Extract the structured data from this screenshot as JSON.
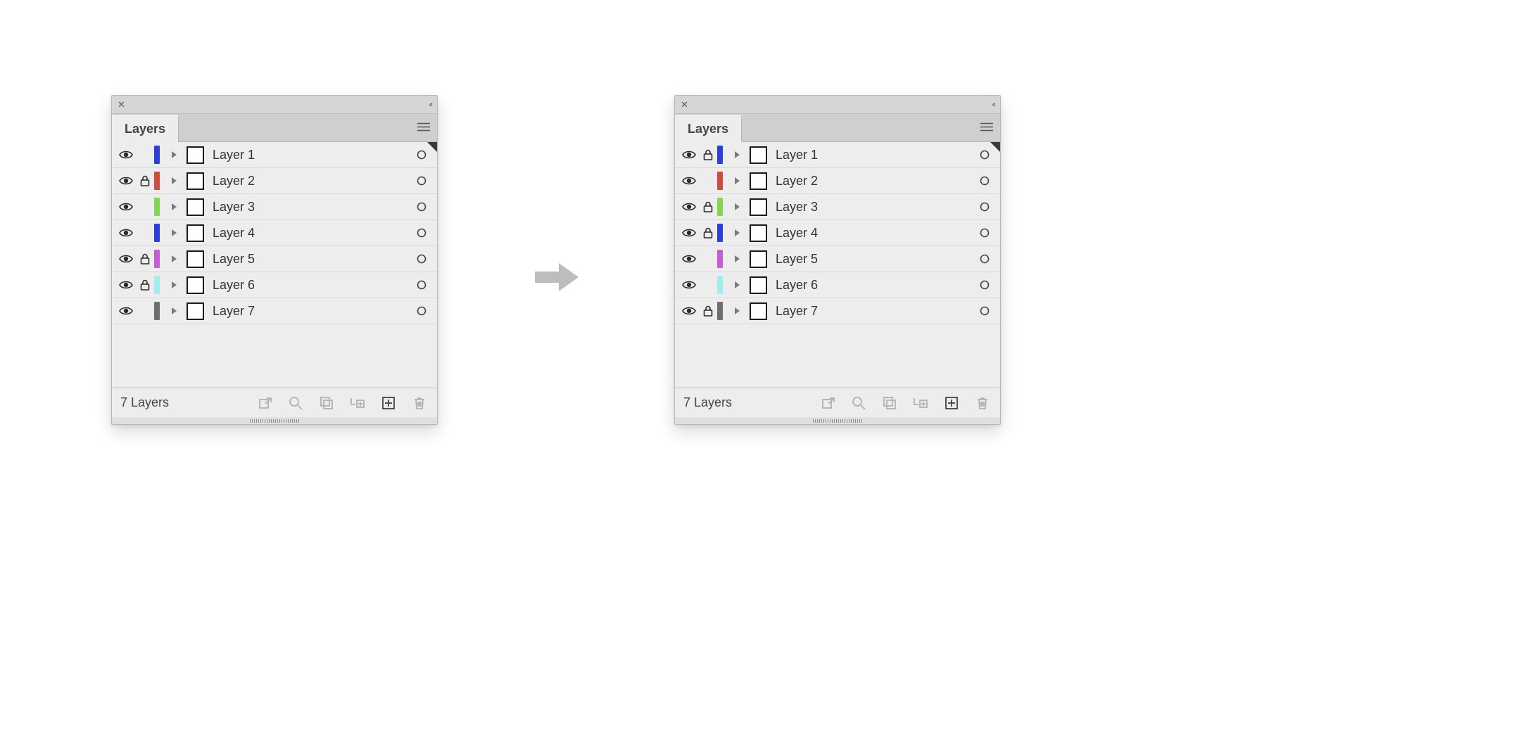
{
  "chrome": {
    "close_glyph": "✕",
    "collapse_glyph": "‹‹"
  },
  "tab": {
    "title": "Layers"
  },
  "panel_before": {
    "rows": [
      {
        "visible": true,
        "locked": false,
        "color": "#2a3fe0",
        "name": "Layer 1"
      },
      {
        "visible": true,
        "locked": true,
        "color": "#cc4d3b",
        "name": "Layer 2"
      },
      {
        "visible": true,
        "locked": false,
        "color": "#7fd84e",
        "name": "Layer 3"
      },
      {
        "visible": true,
        "locked": false,
        "color": "#2a3fe0",
        "name": "Layer 4"
      },
      {
        "visible": true,
        "locked": true,
        "color": "#c85cd8",
        "name": "Layer 5"
      },
      {
        "visible": true,
        "locked": true,
        "color": "#9ef0ef",
        "name": "Layer 6"
      },
      {
        "visible": true,
        "locked": false,
        "color": "#6f6f6f",
        "name": "Layer 7"
      }
    ]
  },
  "panel_after": {
    "rows": [
      {
        "visible": true,
        "locked": true,
        "color": "#2a3fe0",
        "name": "Layer 1"
      },
      {
        "visible": true,
        "locked": false,
        "color": "#cc4d3b",
        "name": "Layer 2"
      },
      {
        "visible": true,
        "locked": true,
        "color": "#7fd84e",
        "name": "Layer 3"
      },
      {
        "visible": true,
        "locked": true,
        "color": "#2a3fe0",
        "name": "Layer 4"
      },
      {
        "visible": true,
        "locked": false,
        "color": "#c85cd8",
        "name": "Layer 5"
      },
      {
        "visible": true,
        "locked": false,
        "color": "#9ef0ef",
        "name": "Layer 6"
      },
      {
        "visible": true,
        "locked": true,
        "color": "#6f6f6f",
        "name": "Layer 7"
      }
    ]
  },
  "footer": {
    "count_label": "7 Layers"
  }
}
